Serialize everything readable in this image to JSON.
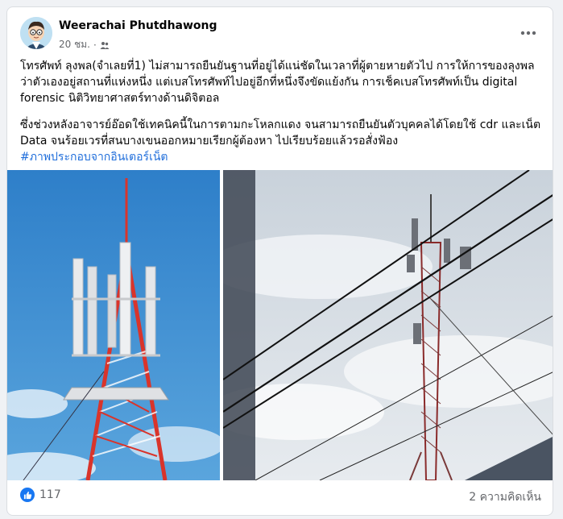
{
  "post": {
    "author": "Weerachai Phutdhawong",
    "time": "20 ชม.",
    "paragraphs": [
      "โทรศัพท์ ลุงพล(จำเลยที่1) ไม่สามารถยืนยันฐานที่อยู่ได้แน่ชัดในเวลาที่ผู้ตายหายตัวไป การให้การของลุงพลว่าตัวเองอยู่สถานที่แห่งหนึ่ง แต่เบสโทรศัพท์ไปอยู่อีกที่หนึ่งจึงขัดแย้งกัน การเช็คเบสโทรศัพท์เป็น digital forensic นิติวิทยาศาสตร์ทางด้านดิจิตอล",
      "ซึ่งช่วงหลังอาจารย์อ๊อดใช้เทคนิคนี้ในการตามกะโหลกแดง จนสามารถยืนยันตัวบุคคลได้โดยใช้ cdr และเน็ต Data จนร้อยเวรที่สนบางเขนออกหมายเรียกผู้ต้องหา ไปเรียบร้อยแล้วรอสั่งฟ้อง"
    ],
    "hashtag": "#ภาพประกอบจากอินเตอร์เน็ต"
  },
  "footer": {
    "like_count": "117",
    "comments_label": "2 ความคิดเห็น"
  },
  "icons": {
    "more": "more-horizontal-icon",
    "privacy": "friends-icon",
    "like": "like-icon"
  },
  "colors": {
    "link": "#216fdb",
    "like_blue": "#1877f2",
    "tower_red": "#d9342b"
  }
}
